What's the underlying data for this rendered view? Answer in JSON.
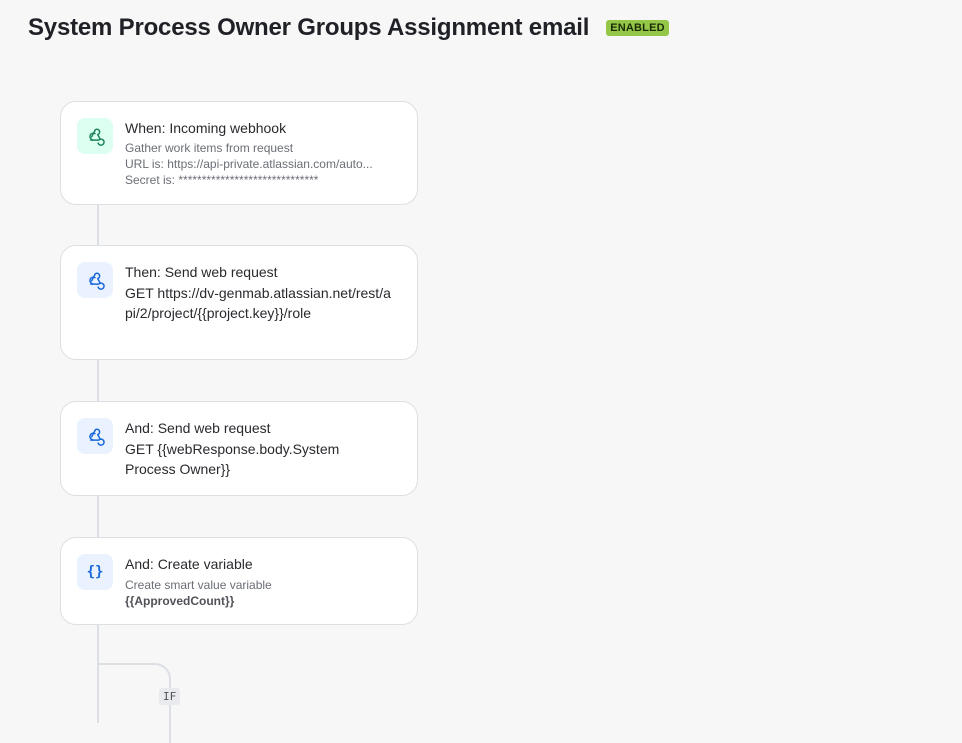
{
  "header": {
    "title": "System Process Owner Groups Assignment email",
    "status_badge": "ENABLED"
  },
  "steps": [
    {
      "icon": "webhook-icon",
      "title": "When: Incoming webhook",
      "lines": [
        "Gather work items from request",
        "URL is: https://api-private.atlassian.com/auto...",
        "Secret is: ******************************"
      ]
    },
    {
      "icon": "webhook-icon",
      "title": "Then: Send web request",
      "detail": "GET https://dv-genmab.atlassian.net/rest/api/2/project/{{project.key}}/role"
    },
    {
      "icon": "webhook-icon",
      "title": "And: Send web request",
      "detail": "GET {{webResponse.body.System Process Owner}}"
    },
    {
      "icon": "curly-braces-icon",
      "title": "And: Create variable",
      "sub": "Create smart value variable",
      "variable": "{{ApprovedCount}}"
    }
  ],
  "branch": {
    "label": "IF"
  },
  "colors": {
    "badge_bg": "#94c748",
    "webhook_green": "#1f845a",
    "webhook_blue": "#1868db"
  }
}
